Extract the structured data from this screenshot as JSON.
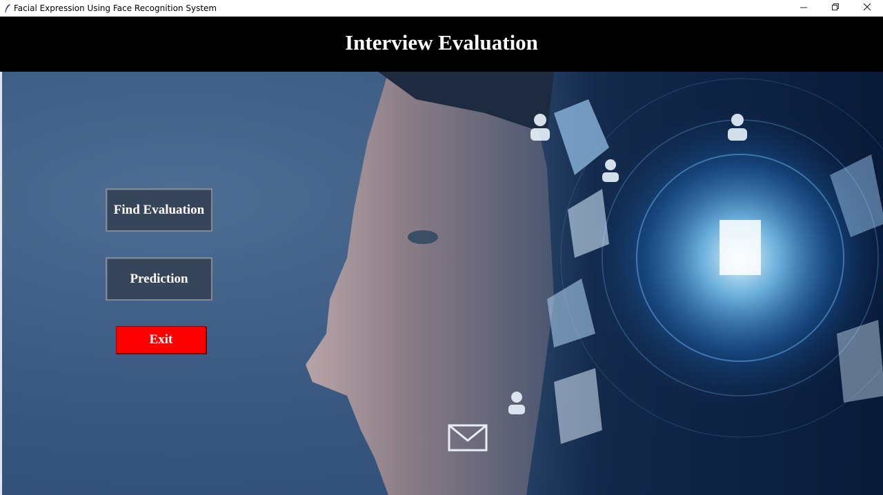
{
  "window": {
    "title": "Facial Expression Using Face Recognition System",
    "controls": {
      "minimize": "minimize-icon",
      "restore": "restore-icon",
      "close": "close-icon"
    }
  },
  "header": {
    "title": "Interview Evaluation",
    "background": "#000000"
  },
  "buttons": {
    "find_evaluation": "Find Evaluation",
    "prediction": "Prediction",
    "exit": "Exit"
  },
  "colors": {
    "button_dark": "#36455a",
    "button_exit": "#ff0000",
    "background_blue": "#3a5a82"
  },
  "background_image": "profile-face-with-digital-network-hologram"
}
